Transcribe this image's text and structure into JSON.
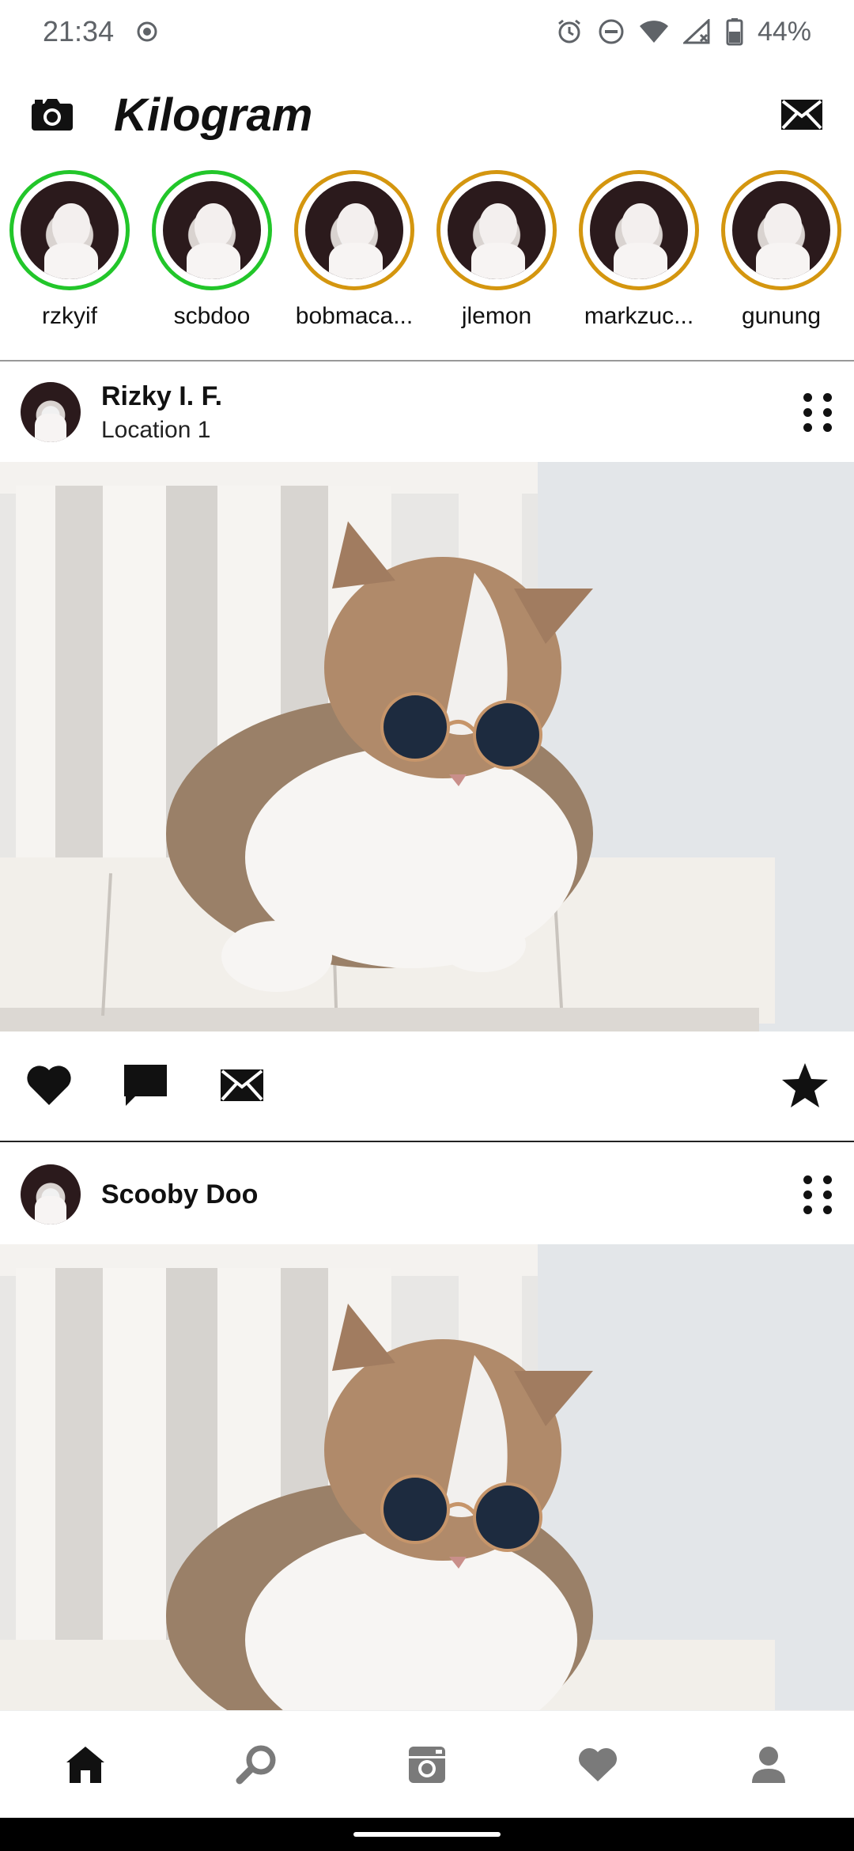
{
  "status": {
    "time": "21:34",
    "battery": "44%"
  },
  "appbar": {
    "title": "Kilogram",
    "camera_icon": "camera-icon",
    "messages_icon": "envelope-icon"
  },
  "stories": [
    {
      "name": "rzkyif",
      "seen": true
    },
    {
      "name": "scbdoo",
      "seen": true
    },
    {
      "name": "bobmaca...",
      "seen": false
    },
    {
      "name": "jlemon",
      "seen": false
    },
    {
      "name": "markzuc...",
      "seen": false
    },
    {
      "name": "gunung",
      "seen": false
    }
  ],
  "posts": [
    {
      "user": "Rizky I. F.",
      "location": "Location 1"
    },
    {
      "user": "Scooby Doo",
      "location": ""
    }
  ],
  "colors": {
    "story_seen": "#22c62a",
    "story_unseen": "#d4960f",
    "icon": "#111111",
    "nav_inactive": "#7a7a7a"
  }
}
